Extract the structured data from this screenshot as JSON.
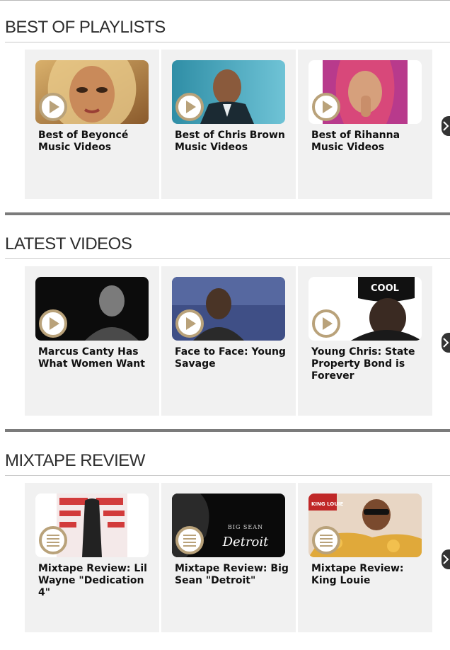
{
  "sections": [
    {
      "title": "BEST OF PLAYLISTS",
      "badge": "play-icon",
      "cards": [
        {
          "title": "Best of Beyoncé Music Videos"
        },
        {
          "title": "Best of Chris Brown Music Videos"
        },
        {
          "title": "Best of Rihanna Music Videos"
        }
      ]
    },
    {
      "title": "LATEST VIDEOS",
      "badge": "play-icon",
      "cards": [
        {
          "title": "Marcus Canty Has What Women Want"
        },
        {
          "title": "Face to Face: Young Savage"
        },
        {
          "title": "Young Chris: State Property Bond is Forever"
        }
      ]
    },
    {
      "title": "MIXTAPE REVIEW",
      "badge": "article-icon",
      "cards": [
        {
          "title": "Mixtape Review: Lil Wayne \"Dedication 4\""
        },
        {
          "title": "Mixtape Review: Big Sean \"Detroit\""
        },
        {
          "title": "Mixtape Review: King Louie"
        }
      ]
    }
  ],
  "thumb_text": {
    "big_sean_line1": "BIG SEAN",
    "big_sean_line2": "Detroit",
    "cap_text": "COOL",
    "king_louie": "KING LOUIE"
  },
  "colors": {
    "badge_ring": "#b9a27a",
    "badge_fill": "#ffffff",
    "card_bg": "#f1f1f1",
    "divider": "#7b7b7b"
  }
}
